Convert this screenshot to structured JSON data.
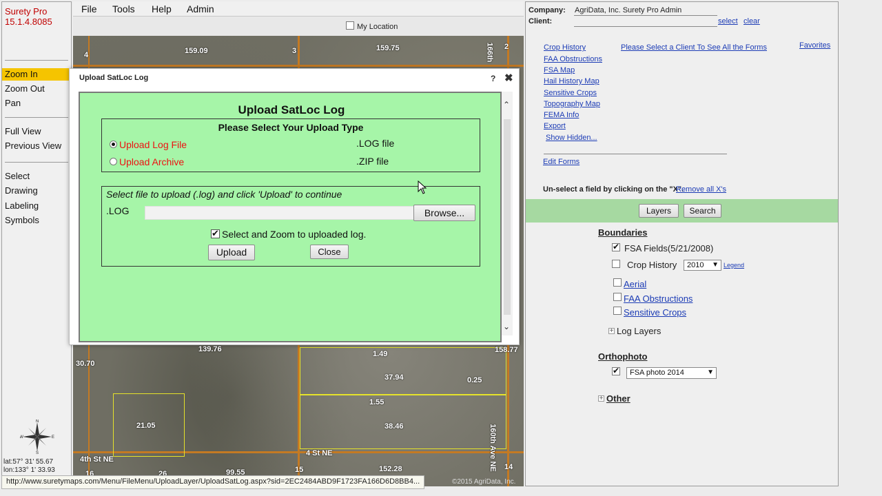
{
  "app": {
    "name": "Surety Pro",
    "version": "15.1.4.8085"
  },
  "tools": {
    "zoom_in": "Zoom In",
    "zoom_out": "Zoom Out",
    "pan": "Pan",
    "full_view": "Full View",
    "previous_view": "Previous View",
    "select": "Select",
    "drawing": "Drawing",
    "labeling": "Labeling",
    "symbols": "Symbols"
  },
  "compass": {
    "n": "N",
    "s": "S",
    "e": "E",
    "w": "W"
  },
  "coords": {
    "lat": "lat:57° 31' 55.67",
    "lon": "lon:133° 1' 33.93"
  },
  "menu": [
    "File",
    "Tools",
    "Help",
    "Admin"
  ],
  "map": {
    "my_location": "My Location",
    "labels": [
      "159.09",
      "159.75",
      "139.76",
      "30.70",
      "1.49",
      "37.94",
      "0.25",
      "158.77",
      "1.55",
      "21.05",
      "38.46",
      "152.28",
      "99.55",
      "4th St NE",
      "4 St NE",
      "166th",
      "160th Ave NE",
      "4",
      "3",
      "2",
      "16",
      "15",
      "14",
      "26"
    ],
    "copyright": "©2015 AgriData, Inc."
  },
  "status_url": "http://www.suretymaps.com/Menu/FileMenu/UploadLayer/UploadSatLog.aspx?sid=2EC2484ABD9F1723FA166D6D8BB4...",
  "right": {
    "company_label": "Company:",
    "company_value": "AgriData, Inc. Surety Pro Admin",
    "client_label": "Client:",
    "client_select": "select",
    "client_clear": "clear",
    "reports": [
      "Crop History",
      "FAA Obstructions",
      "FSA Map",
      "Hail History Map",
      "Sensitive Crops",
      "Topography Map",
      "FEMA Info",
      "Export"
    ],
    "show_hidden": "Show Hidden...",
    "select_client_msg": "Please Select a Client To See All the Forms",
    "favorites": "Favorites",
    "edit_forms": "Edit Forms",
    "unselect_msg": "Un-select a field by clicking on the \"X\".",
    "remove_all": "Remove all X's",
    "layers_btn": "Layers",
    "search_btn": "Search",
    "boundaries": "Boundaries",
    "fsa_fields": "FSA Fields(5/21/2008)",
    "crop_history": "Crop History",
    "crop_year": "2010",
    "legend": "Legend",
    "aerial": "Aerial",
    "faa": "FAA Obstructions",
    "sensitive": "Sensitive Crops",
    "log_layers": "Log Layers",
    "orthophoto": "Orthophoto",
    "ortho_value": "FSA photo 2014",
    "other": "Other"
  },
  "dialog": {
    "title": "Upload SatLoc Log",
    "help": "?",
    "close_x": "✖",
    "heading": "Upload SatLoc Log",
    "type_prompt": "Please Select Your Upload Type",
    "opt1": "Upload Log File",
    "opt1_ext": ".LOG file",
    "opt2": "Upload Archive",
    "opt2_ext": ".ZIP file",
    "instructions": "Select file to upload (.log) and click 'Upload' to continue",
    "file_ext": ".LOG",
    "browse": "Browse...",
    "zoom_label": "Select and Zoom to uploaded log.",
    "upload": "Upload",
    "close": "Close"
  }
}
